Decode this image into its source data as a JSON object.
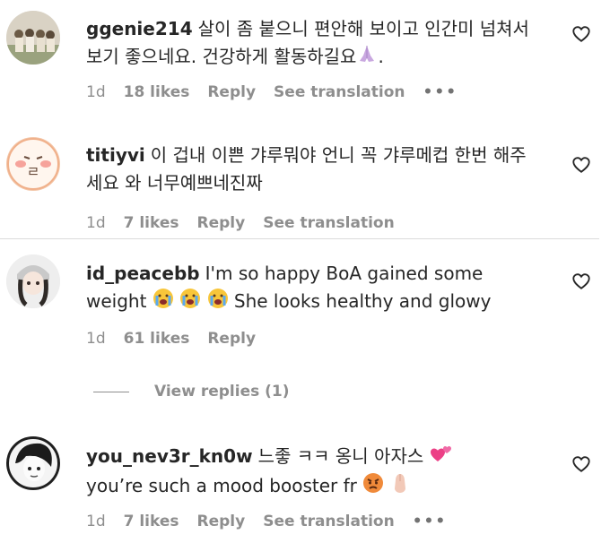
{
  "comments": [
    {
      "username": "ggenie214",
      "text_before_emoji": "살이 좀 붙으니 편안해 보이고 인간미 넘쳐서 보기 좋으네요. 건강하게 활동하길요",
      "text_after_emoji": ".",
      "time": "1d",
      "likes": "18 likes",
      "reply": "Reply",
      "translation": "See translation",
      "more": "•••"
    },
    {
      "username": "titiyvi",
      "text": "이 겁내 이쁜 갸루뭐야 언니 꼭 갸루메컵 한번 해주세요 와 너무예쁘네진짜",
      "time": "1d",
      "likes": "7 likes",
      "reply": "Reply",
      "translation": "See translation"
    },
    {
      "username": "id_peacebb",
      "text_before_emoji": "I'm so happy BoA gained some weight",
      "text_after_emoji": "She looks healthy and glowy",
      "time": "1d",
      "likes": "61 likes",
      "reply": "Reply",
      "view_replies": "View replies (1)"
    },
    {
      "username": "you_nev3r_kn0w",
      "line1": "느좋 ㅋㅋ 옹니 아자스",
      "line2": "you’re such a mood booster fr",
      "time": "1d",
      "likes": "7 likes",
      "reply": "Reply",
      "translation": "See translation",
      "more": "•••"
    }
  ],
  "colors": {
    "text": "#262626",
    "meta": "#8e8e8e",
    "divider": "#dbdbdb"
  },
  "icons": {
    "like": "heart-outline-icon",
    "more": "more-dots-icon"
  }
}
